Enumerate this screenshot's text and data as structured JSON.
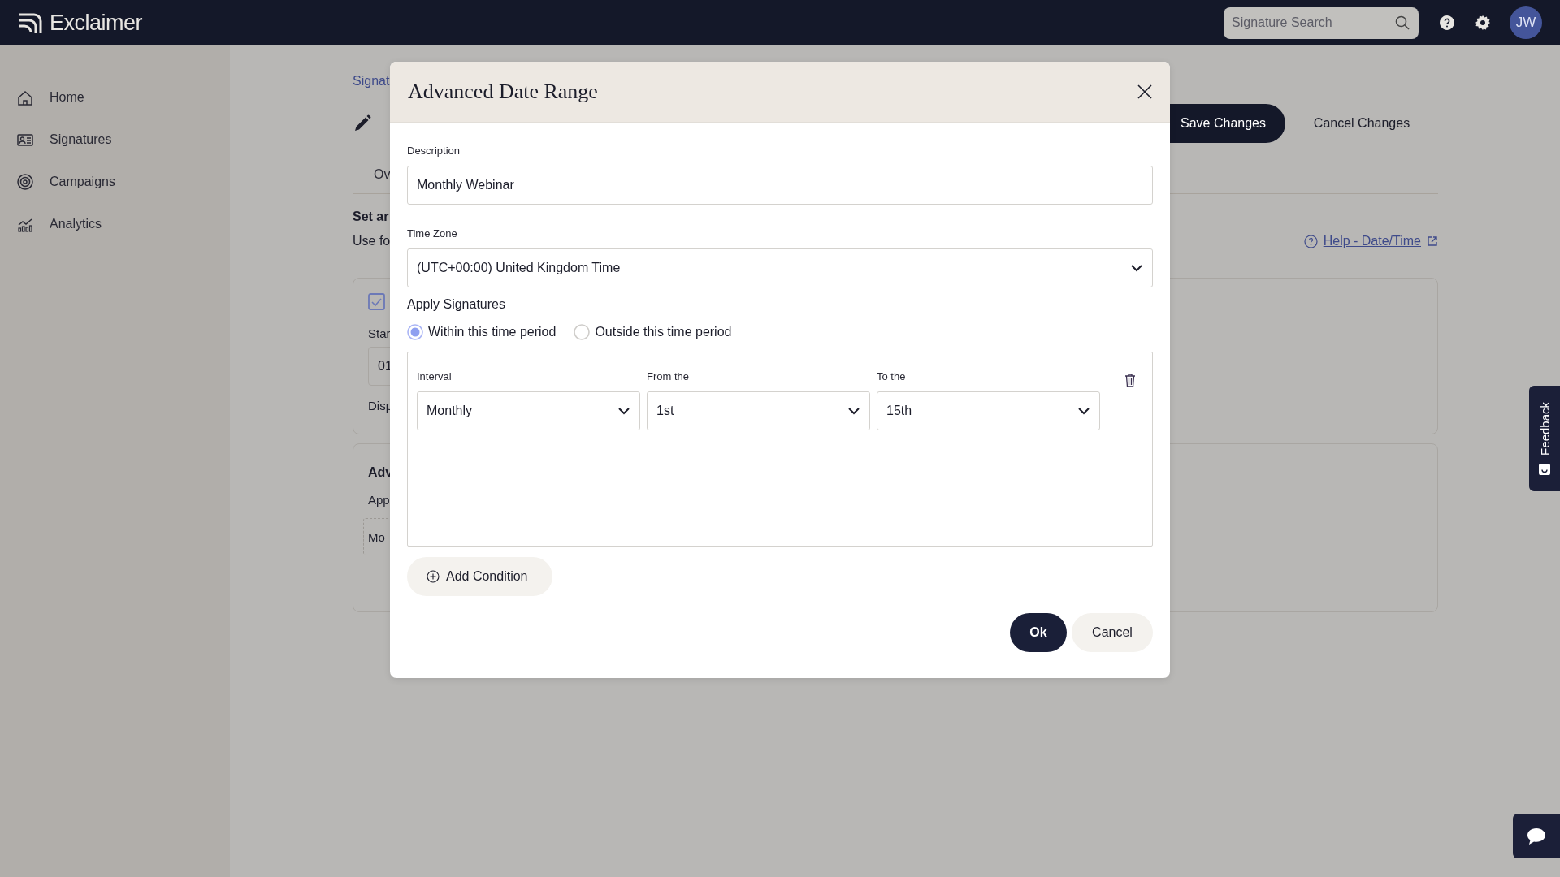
{
  "header": {
    "logo": "Exclaimer",
    "search": {
      "placeholder": "Signature Search"
    },
    "avatar": "JW"
  },
  "sidebar": {
    "items": [
      {
        "label": "Home",
        "kind": "home"
      },
      {
        "label": "Signatures",
        "kind": "card"
      },
      {
        "label": "Campaigns",
        "kind": "target"
      },
      {
        "label": "Analytics",
        "kind": "chart"
      }
    ]
  },
  "page": {
    "breadcrumb": "Signat",
    "tab": "Ov",
    "save_button": "Save Changes",
    "cancel_button": "Cancel Changes",
    "heading": "Set ar",
    "intro": "Use fo",
    "help_link": "Help - Date/Time",
    "date_card": {
      "checked": true,
      "start_label": "Star",
      "start_value": "01",
      "display_label": "Disp"
    },
    "advanced_card": {
      "title": "Adv",
      "text": "App",
      "chip": "Mo"
    }
  },
  "dialog": {
    "title": "Advanced Date Range",
    "description": {
      "label": "Description",
      "value": "Monthly Webinar"
    },
    "time_zone": {
      "label": "Time Zone",
      "value": "(UTC+00:00) United Kingdom Time"
    },
    "apply": {
      "label": "Apply Signatures",
      "options": [
        {
          "label": "Within this time period",
          "selected": true
        },
        {
          "label": "Outside this time period",
          "selected": false
        }
      ]
    },
    "conditions": [
      {
        "fields": [
          {
            "label": "Interval",
            "value": "Monthly"
          },
          {
            "label": "From the",
            "value": "1st"
          },
          {
            "label": "To the",
            "value": "15th"
          }
        ]
      }
    ],
    "add_condition": "Add Condition",
    "buttons": [
      {
        "label": "Ok",
        "kind": "primary"
      },
      {
        "label": "Cancel",
        "kind": "secondary"
      }
    ]
  },
  "feedback_tab": "Feedback"
}
